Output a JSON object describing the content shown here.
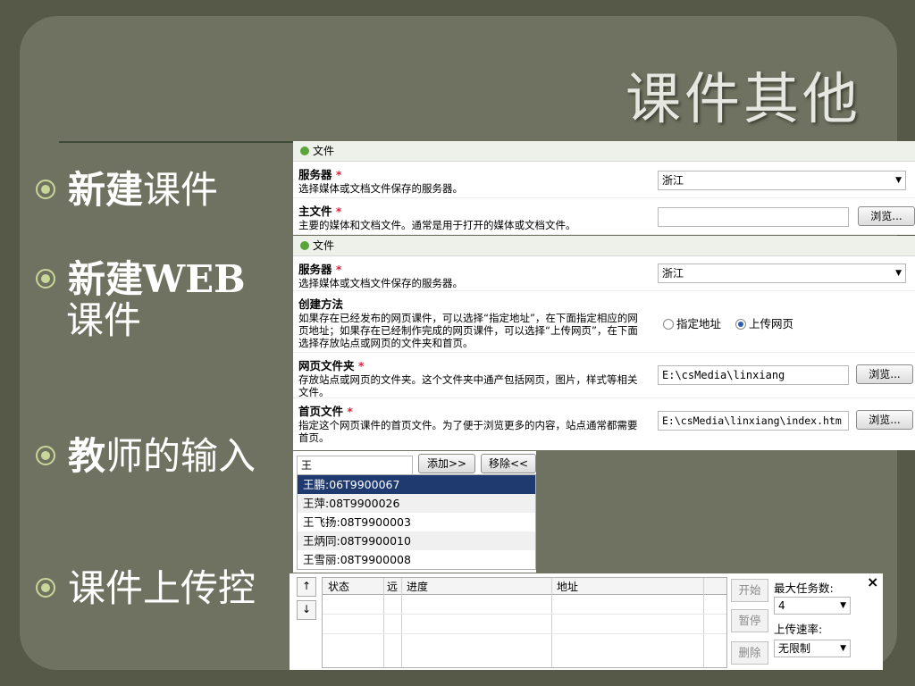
{
  "slide": {
    "title": "课件其他",
    "bullets": [
      {
        "bold": "新建",
        "rest": "课件"
      },
      {
        "bold": "新建WEB",
        "rest": "课件"
      },
      {
        "bold": "教",
        "rest": "师的输入"
      },
      {
        "bold": "",
        "rest": "课件上传控"
      }
    ]
  },
  "panel1": {
    "section": "文件",
    "rows": [
      {
        "title": "服务器",
        "required": "*",
        "desc": "选择媒体或文档文件保存的服务器。",
        "value": "浙江"
      },
      {
        "title": "主文件",
        "required": "*",
        "desc": "主要的媒体和文档文件。通常是用于打开的媒体或文档文件。",
        "value": "",
        "button": "浏览..."
      }
    ]
  },
  "panel2": {
    "section": "文件",
    "server": {
      "title": "服务器",
      "required": "*",
      "desc": "选择媒体或文档文件保存的服务器。",
      "value": "浙江"
    },
    "method": {
      "title": "创建方法",
      "desc": "如果存在已经发布的网页课件，可以选择“指定地址”，在下面指定相应的网页地址；如果存在已经制作完成的网页课件，可以选择“上传网页”，在下面选择存放站点或网页的文件夹和首页。",
      "option1": "指定地址",
      "option2": "上传网页"
    },
    "folder": {
      "title": "网页文件夹",
      "required": "*",
      "desc": "存放站点或网页的文件夹。这个文件夹中通产包括网页，图片，样式等相关文件。",
      "value": "E:\\csMedia\\linxiang",
      "button": "浏览..."
    },
    "home": {
      "title": "首页文件",
      "required": "*",
      "desc": "指定这个网页课件的首页文件。为了便于浏览更多的内容，站点通常都需要首页。",
      "value": "E:\\csMedia\\linxiang\\index.htm",
      "button": "浏览..."
    }
  },
  "teacher": {
    "search_value": "王",
    "add_button": "添加>>",
    "remove_button": "移除<<",
    "items": [
      "王鹏:06T9900067",
      "王萍:08T9900026",
      "王飞扬:08T9900003",
      "王炳同:08T9900010",
      "王雪丽:08T9900008"
    ]
  },
  "upload": {
    "up_arrow": "↑",
    "down_arrow": "↓",
    "columns": [
      "状态",
      "远",
      "进度",
      "地址"
    ],
    "start": "开始",
    "pause": "暂停",
    "delete": "删除",
    "max_tasks_label": "最大任务数:",
    "max_tasks_value": "4",
    "rate_label": "上传速率:",
    "rate_value": "无限制",
    "close": "×"
  }
}
